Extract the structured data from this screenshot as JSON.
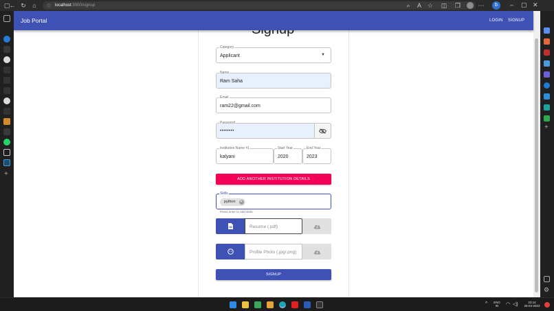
{
  "browser": {
    "url_host": "localhost",
    "url_path": ":3000/signup"
  },
  "app": {
    "brand": "Job Portal",
    "nav": {
      "login": "LOGIN",
      "signup": "SIGNUP"
    }
  },
  "form": {
    "title": "Signup",
    "category": {
      "label": "Category",
      "value": "Applicant"
    },
    "name": {
      "label": "Name",
      "value": "Ram Saha"
    },
    "email": {
      "label": "Email",
      "value": "ram22@gmail.com"
    },
    "password": {
      "label": "Password",
      "value": "••••••••"
    },
    "institution": {
      "label": "Institution Name #1",
      "value": "kalyani"
    },
    "start_year": {
      "label": "Start Year",
      "value": "2020"
    },
    "end_year": {
      "label": "End Year",
      "value": "2023"
    },
    "add_institution_label": "ADD ANOTHER INSTITUTION DETAILS",
    "skills": {
      "label": "Skills",
      "chips": [
        "python"
      ],
      "helper": "Press enter to add skills"
    },
    "resume": {
      "placeholder": "Resume (.pdf)"
    },
    "profile_photo": {
      "placeholder": "Profile Photo (.jpg/.png)"
    },
    "submit_label": "SIGNUP"
  },
  "taskbar": {
    "lang": "ENG",
    "region": "IN",
    "time": "23:14",
    "date": "28-04-2023"
  },
  "colors": {
    "primary": "#3f51b5",
    "secondary": "#f50057",
    "autofill": "#e8f0fe"
  }
}
